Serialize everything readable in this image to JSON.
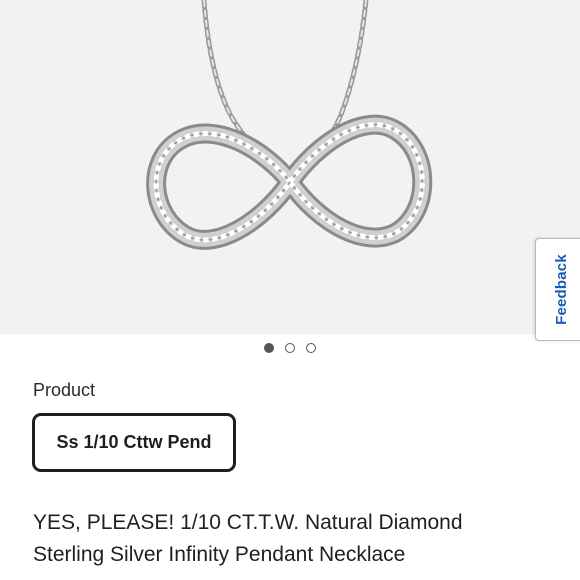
{
  "gallery": {
    "image_alt": "infinity-pendant-necklace",
    "dots": [
      {
        "state": "active"
      },
      {
        "state": "inactive"
      },
      {
        "state": "inactive"
      }
    ]
  },
  "feedback": {
    "label": "Feedback"
  },
  "product": {
    "section_label": "Product",
    "selected_variant": "Ss 1/10 Cttw Pend",
    "title_line1": "YES, PLEASE! 1/10 CT.T.W. Natural Diamond",
    "title_line2": "Sterling Silver Infinity Pendant Necklace"
  },
  "colors": {
    "feedback_text": "#1a5bb5",
    "hero_background": "#f2f2f2",
    "button_border": "#1f1f1f"
  }
}
